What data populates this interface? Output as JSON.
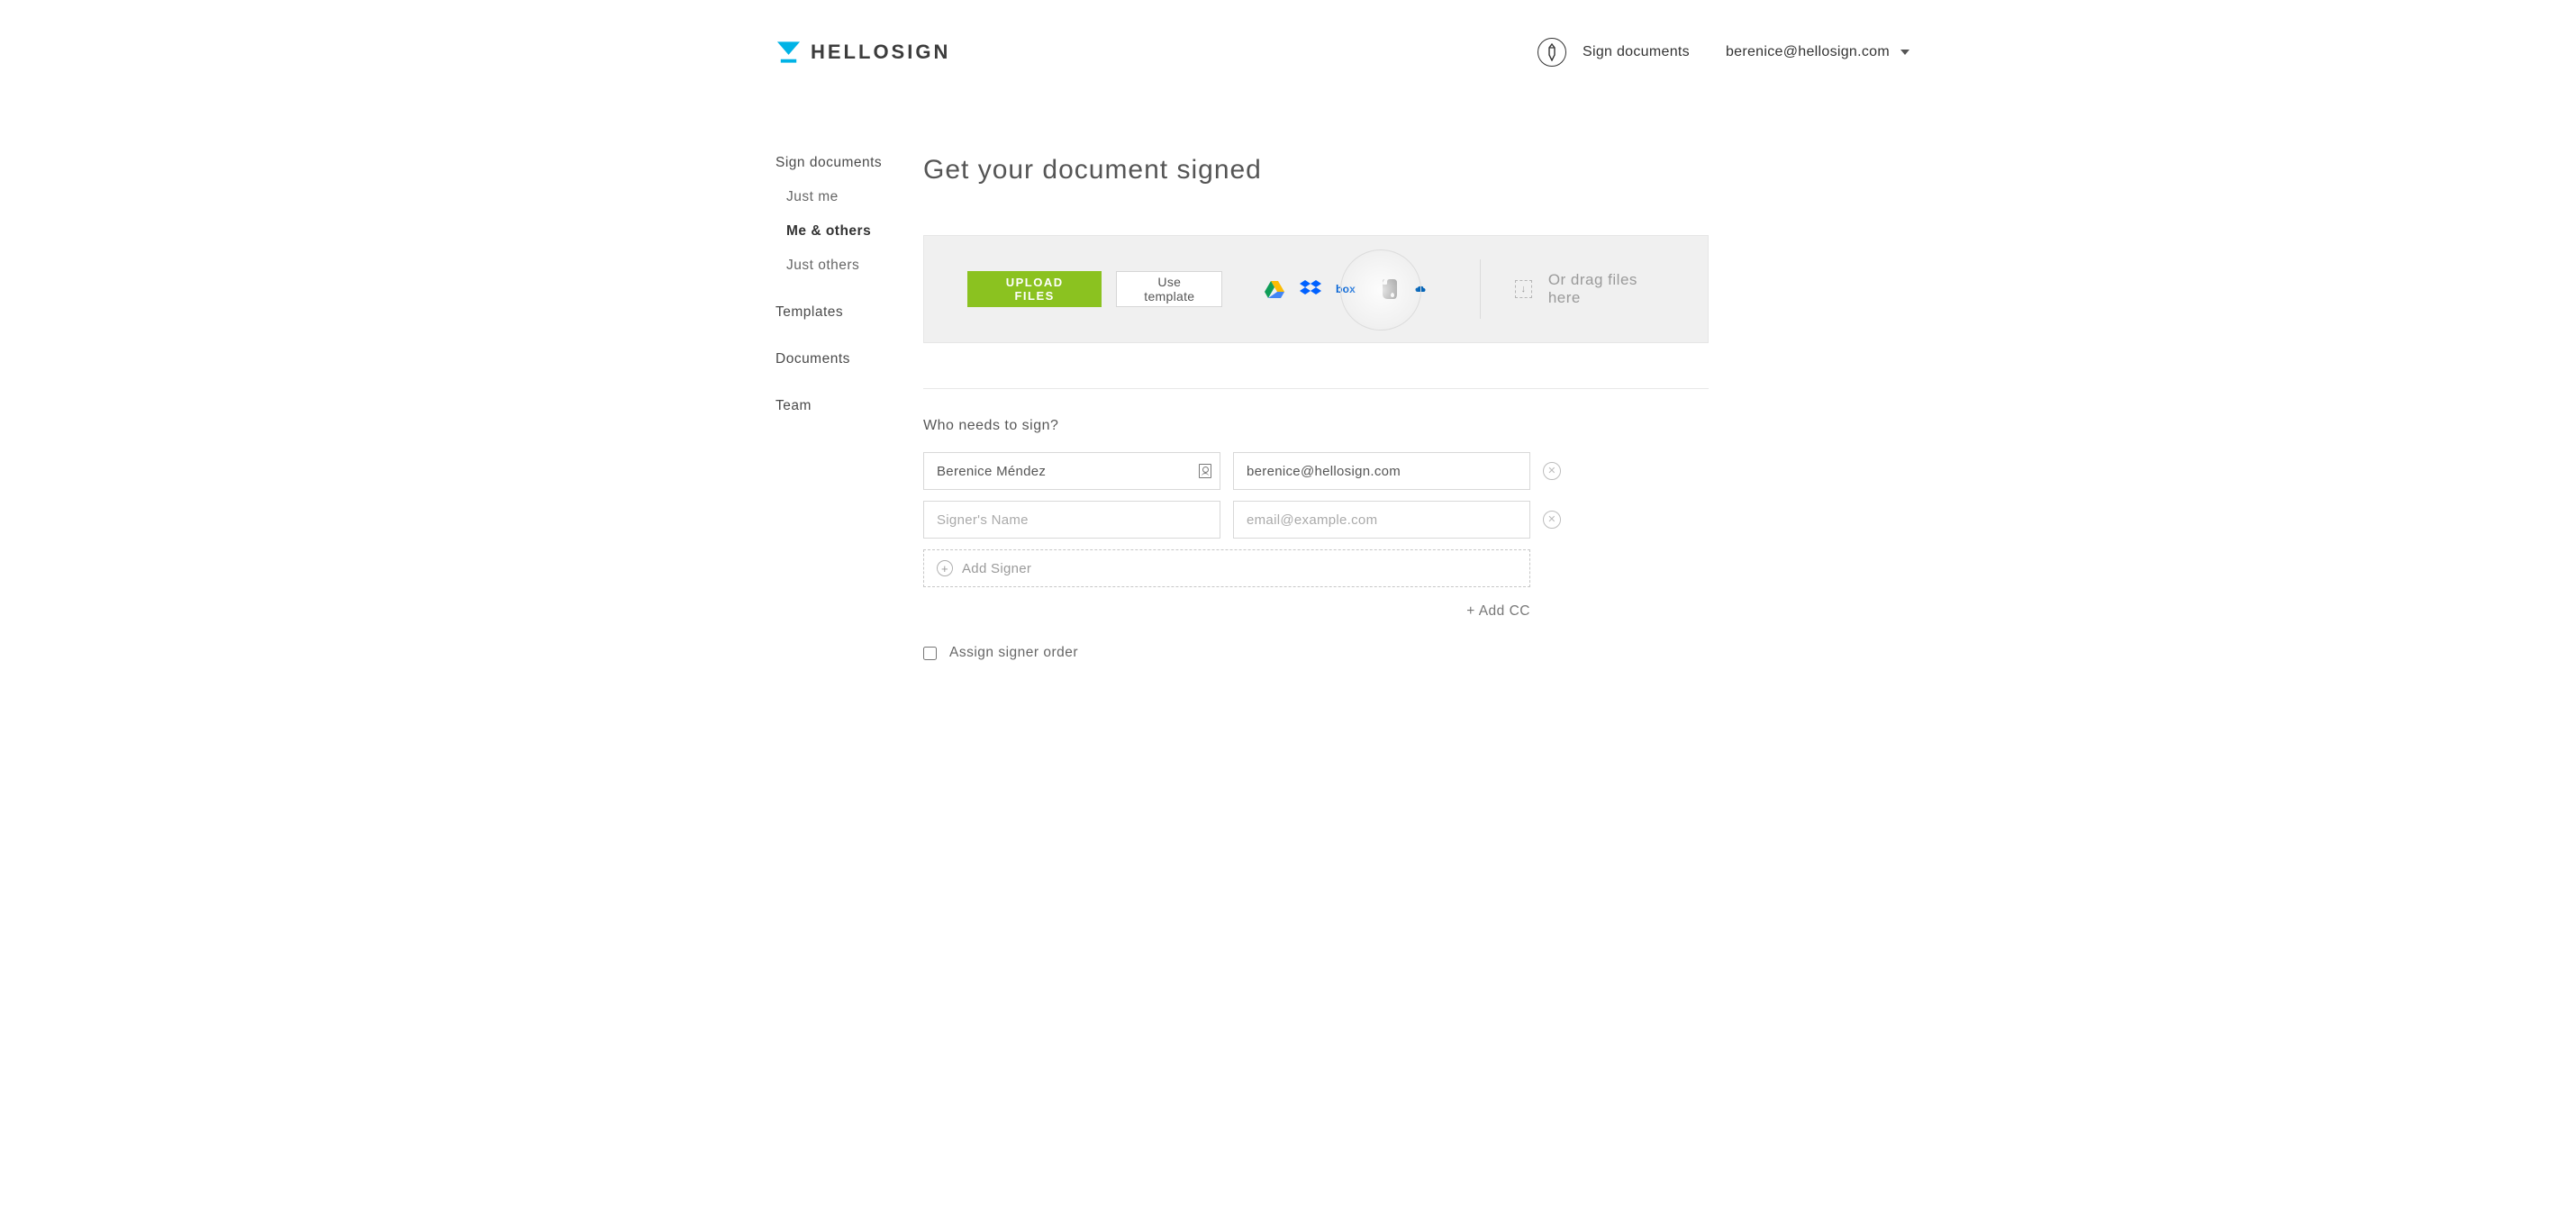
{
  "header": {
    "logo_text": "HELLOSIGN",
    "sign_link": "Sign documents",
    "user_email": "berenice@hellosign.com"
  },
  "sidebar": {
    "sign_documents": "Sign documents",
    "just_me": "Just me",
    "me_and_others": "Me & others",
    "just_others": "Just others",
    "templates": "Templates",
    "documents": "Documents",
    "team": "Team"
  },
  "main": {
    "title": "Get your document signed",
    "upload": {
      "upload_btn": "UPLOAD FILES",
      "template_btn": "Use template",
      "drag_text": "Or drag files here",
      "cloud_services": [
        "google-drive",
        "dropbox",
        "box",
        "evernote",
        "onedrive"
      ]
    },
    "signers": {
      "heading": "Who needs to sign?",
      "rows": [
        {
          "name": "Berenice Méndez",
          "email": "berenice@hellosign.com"
        },
        {
          "name": "",
          "email": ""
        }
      ],
      "name_placeholder": "Signer's Name",
      "email_placeholder": "email@example.com",
      "add_signer": "Add Signer",
      "add_cc": "+ Add CC",
      "assign_order": "Assign signer order"
    }
  }
}
